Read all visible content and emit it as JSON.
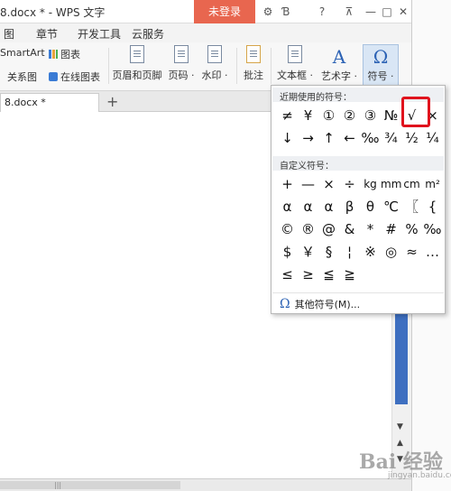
{
  "window": {
    "title": "8.docx * - WPS 文字",
    "login_label": "未登录",
    "controls": [
      "gear-icon",
      "theme-icon",
      "help-icon",
      "pin-icon",
      "minimize-icon",
      "maximize-icon",
      "close-icon"
    ]
  },
  "menu": {
    "items": [
      "图",
      "章节",
      "开发工具",
      "云服务"
    ]
  },
  "ribbon": {
    "smartart_label": "SmartArt",
    "chart_label": "图表",
    "relation_label": "关系图",
    "online_chart_label": "在线图表",
    "header_footer_label": "页眉和页脚",
    "page_number_label": "页码 ·",
    "watermark_label": "水印 ·",
    "comment_label": "批注",
    "textbox_label": "文本框 ·",
    "art_label": "艺术字 ·",
    "symbol_label": "符号 ·",
    "symbol_glyph": "Ω",
    "art_glyph": "A"
  },
  "tabs": {
    "doc_tab_label": "8.docx *",
    "new_tab_glyph": "+"
  },
  "symbol_panel": {
    "recent_header": "近期使用的符号：",
    "recent": [
      [
        "≠",
        "¥",
        "①",
        "②",
        "③",
        "№",
        "√",
        "×"
      ],
      [
        "↓",
        "→",
        "↑",
        "←",
        "‰",
        "¾",
        "½",
        "¼"
      ]
    ],
    "custom_header": "自定义符号：",
    "custom": [
      [
        "+",
        "—",
        "×",
        "÷",
        "kg",
        "mm",
        "cm",
        "m²"
      ],
      [
        "α",
        "α",
        "α",
        "β",
        "θ",
        "℃",
        "〖",
        "{"
      ],
      [
        "©",
        "®",
        "@",
        "&",
        "*",
        "#",
        "%",
        "‰"
      ],
      [
        "$",
        "￥",
        "§",
        "¦",
        "※",
        "◎",
        "≈",
        "…"
      ],
      [
        "≤",
        "≥",
        "≦",
        "≧"
      ]
    ],
    "more_label": "其他符号(M)..."
  },
  "watermark": {
    "mark": "Bai 经验",
    "sub": "jingyan.baidu.com"
  }
}
